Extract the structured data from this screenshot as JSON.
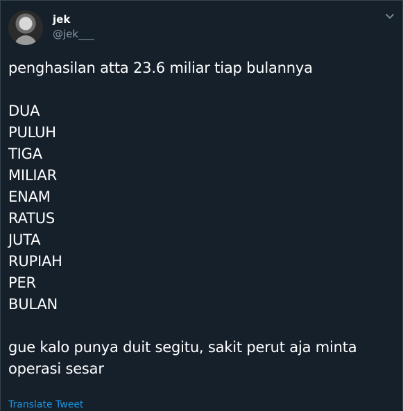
{
  "author": {
    "display_name": "jek",
    "handle": "@jek___"
  },
  "tweet": {
    "intro": "penghasilan atta 23.6 miliar tiap bulannya",
    "words": [
      "DUA",
      "PULUH",
      "TIGA",
      "MILIAR",
      "ENAM",
      "RATUS",
      "JUTA",
      "RUPIAH",
      "PER",
      "BULAN"
    ],
    "outro_line1": "gue kalo punya duit segitu, sakit perut aja minta",
    "outro_line2": "operasi sesar"
  },
  "actions": {
    "translate_label": "Translate Tweet"
  },
  "icons": {
    "menu": "chevron-down-icon"
  },
  "colors": {
    "background": "#15202b",
    "text": "#ffffff",
    "secondary": "#8899a6",
    "link": "#1b95e0",
    "border": "#38444d"
  }
}
